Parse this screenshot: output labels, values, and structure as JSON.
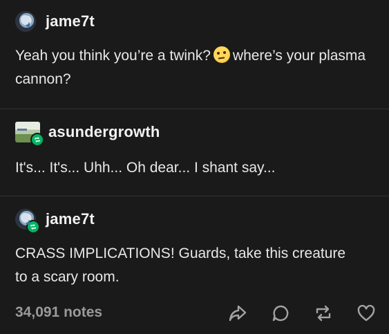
{
  "posts": [
    {
      "username": "jame7t",
      "text_before_emoji": "Yeah you think you’re a twink?",
      "emoji": "face-with-raised-eyebrow",
      "text_after_emoji": "where’s your plasma cannon?"
    },
    {
      "username": "asundergrowth",
      "text": "It's... It's... Uhh... Oh dear... I shant say..."
    },
    {
      "username": "jame7t",
      "text": "CRASS IMPLICATIONS! Guards, take this creature to a scary room."
    }
  ],
  "footer": {
    "notes": "34,091 notes",
    "actions": [
      "share-icon",
      "reply-icon",
      "reblog-icon",
      "like-icon"
    ]
  },
  "colors": {
    "background": "#1a1a1a",
    "text": "#e8e8e8",
    "muted": "#9a9a9a",
    "reblog_green": "#00b562"
  }
}
